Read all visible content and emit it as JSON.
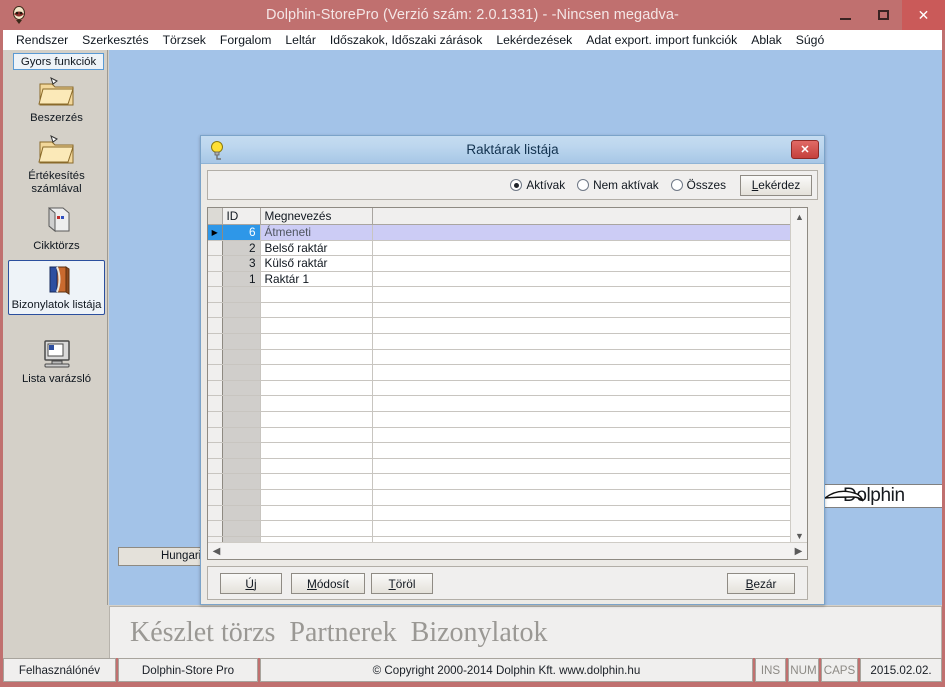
{
  "window": {
    "title": "Dolphin-StorePro  (Verzió szám: 2.0.1331) - -Nincsen megadva-",
    "icon": "app-crest-icon",
    "minimize_label": "–",
    "maximize_label": "□",
    "close_label": "✕"
  },
  "menubar": {
    "items": [
      {
        "label": "Rendszer"
      },
      {
        "label": "Szerkesztés"
      },
      {
        "label": "Törzsek"
      },
      {
        "label": "Forgalom"
      },
      {
        "label": "Leltár"
      },
      {
        "label": "Időszakok, Időszaki zárások"
      },
      {
        "label": "Lekérdezések"
      },
      {
        "label": "Adat export. import funkciók"
      },
      {
        "label": "Ablak"
      },
      {
        "label": "Súgó"
      }
    ]
  },
  "toolbox": {
    "header": "Gyors funkciók",
    "items": [
      {
        "label": "Beszerzés",
        "icon": "folder-open-icon",
        "selected": false
      },
      {
        "label": "Értékesítés\nszámlával",
        "icon": "folder-open-icon",
        "selected": false
      },
      {
        "label": "Cikktörzs",
        "icon": "server-box-icon",
        "selected": false
      },
      {
        "label": "Bizonylatok listája",
        "icon": "book-icon",
        "selected": true
      },
      {
        "label": "Lista varázsló",
        "icon": "monitor-icon",
        "selected": false
      }
    ]
  },
  "workspace": {
    "language_combo": {
      "value": "Hungarian",
      "arrow_icon": "chevron-down-icon"
    },
    "logo": {
      "text": "Dolphin",
      "icon": "dolphin-curve-icon"
    },
    "brand_strip": "Készlet törzs  Partnerek  Bizonylatok"
  },
  "dialog": {
    "title": "Raktárak listája",
    "icon": "lightbulb-icon",
    "close_label": "✕",
    "filter": {
      "options": [
        {
          "label": "Aktívak",
          "selected": true
        },
        {
          "label": "Nem aktívak",
          "selected": false
        },
        {
          "label": "Összes",
          "selected": false
        }
      ],
      "query_button": {
        "accel": "L",
        "rest": "ekérdez"
      }
    },
    "grid": {
      "columns": [
        "ID",
        "Megnevezés"
      ],
      "rows": [
        {
          "id": "6",
          "name": "Átmeneti",
          "selected": true
        },
        {
          "id": "2",
          "name": "Belső raktár",
          "selected": false
        },
        {
          "id": "3",
          "name": "Külső raktár",
          "selected": false
        },
        {
          "id": "1",
          "name": "Raktár 1",
          "selected": false
        }
      ],
      "empty_row_count": 17,
      "row_marker": "▶",
      "scroll_up_icon": "chevron-up-icon",
      "scroll_down_icon": "chevron-down-icon",
      "scroll_left_icon": "chevron-left-icon",
      "scroll_right_icon": "chevron-right-icon"
    },
    "buttons": {
      "new": {
        "accel": "Ú",
        "rest": "j"
      },
      "modify": {
        "accel": "M",
        "rest": "ódosít"
      },
      "delete": {
        "accel": "T",
        "rest": "öröl"
      },
      "close": {
        "accel": "B",
        "rest": "ezár"
      }
    }
  },
  "statusbar": {
    "user": "Felhasználónév",
    "product": "Dolphin-Store Pro",
    "copyright": "© Copyright 2000-2014 Dolphin Kft. www.dolphin.hu",
    "ins": "INS",
    "num": "NUM",
    "caps": "CAPS",
    "date": "2015.02.02."
  }
}
